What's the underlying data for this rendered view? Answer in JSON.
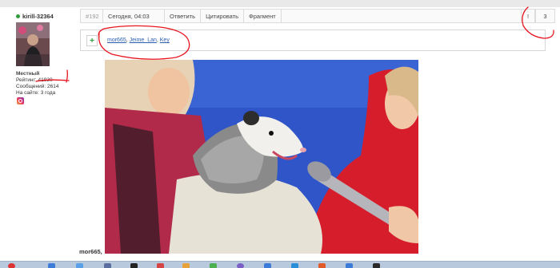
{
  "user": {
    "name": "kirill-32364",
    "status": "Местный",
    "rating_label": "Рейтинг:",
    "rating_value": "41930",
    "messages_label": "Сообщений:",
    "messages_value": "2614",
    "site_label": "На сайте:",
    "site_value": "3 года"
  },
  "post": {
    "number": "#192",
    "date": "Сегодня, 04:03",
    "reply": "Ответить",
    "quote": "Цитировать",
    "fragment": "Фрагмент",
    "page_marker": "!",
    "page_number": "3"
  },
  "thanks": {
    "plus": "+",
    "names": [
      "mor665",
      "Jeime_Lan",
      "Key"
    ],
    "separator": ", "
  },
  "image": {
    "subject": "opossum-with-microphone-photo"
  },
  "quote_author": "mor665,",
  "colors": {
    "online": "#2e9e3a",
    "link": "#2a5db0",
    "annotation": "#e8141e"
  }
}
